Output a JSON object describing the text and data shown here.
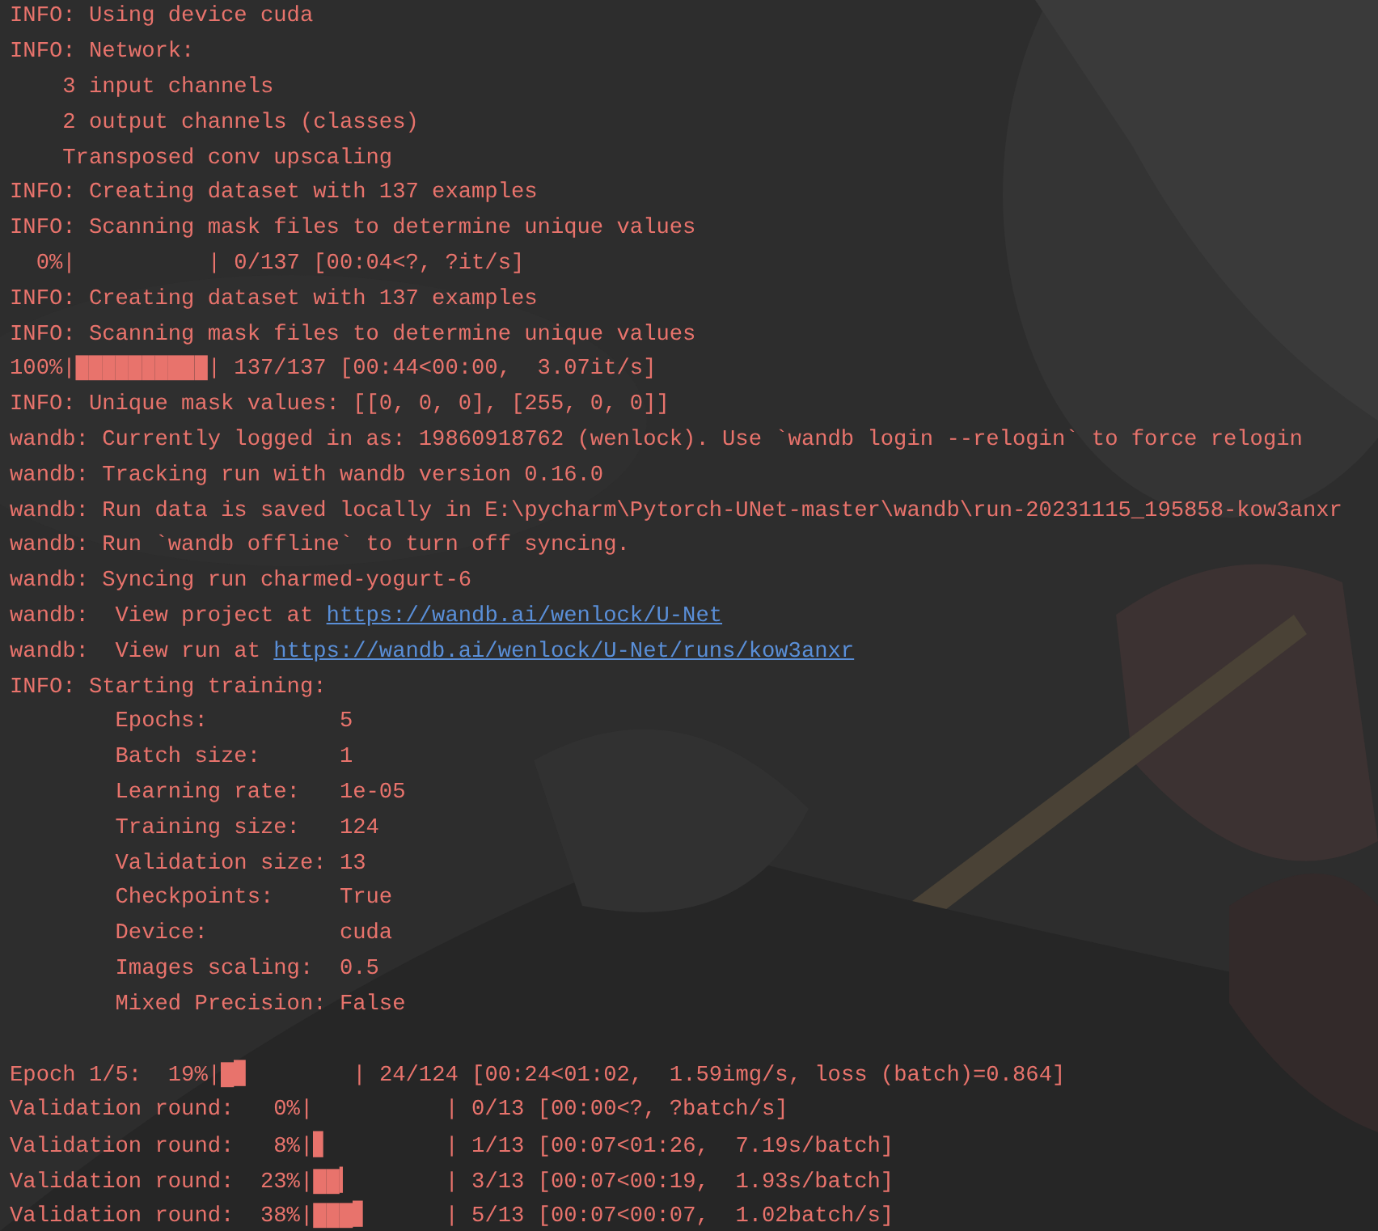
{
  "console": {
    "lines": [
      {
        "kind": "text",
        "text": "INFO: Using device cuda"
      },
      {
        "kind": "text",
        "text": "INFO: Network:"
      },
      {
        "kind": "text",
        "text": "    3 input channels"
      },
      {
        "kind": "text",
        "text": "    2 output channels (classes)"
      },
      {
        "kind": "text",
        "text": "    Transposed conv upscaling"
      },
      {
        "kind": "text",
        "text": "INFO: Creating dataset with 137 examples"
      },
      {
        "kind": "text",
        "text": "INFO: Scanning mask files to determine unique values"
      },
      {
        "kind": "text",
        "text": "  0%|          | 0/137 [00:04<?, ?it/s]"
      },
      {
        "kind": "text",
        "text": "INFO: Creating dataset with 137 examples"
      },
      {
        "kind": "text",
        "text": "INFO: Scanning mask files to determine unique values"
      },
      {
        "kind": "text",
        "text": "100%|██████████| 137/137 [00:44<00:00,  3.07it/s]"
      },
      {
        "kind": "text",
        "text": "INFO: Unique mask values: [[0, 0, 0], [255, 0, 0]]"
      },
      {
        "kind": "text",
        "text": "wandb: Currently logged in as: 19860918762 (wenlock). Use `wandb login --relogin` to force relogin"
      },
      {
        "kind": "text",
        "text": "wandb: Tracking run with wandb version 0.16.0"
      },
      {
        "kind": "text",
        "text": "wandb: Run data is saved locally in E:\\pycharm\\Pytorch-UNet-master\\wandb\\run-20231115_195858-kow3anxr"
      },
      {
        "kind": "text",
        "text": "wandb: Run `wandb offline` to turn off syncing."
      },
      {
        "kind": "text",
        "text": "wandb: Syncing run charmed-yogurt-6"
      },
      {
        "kind": "link",
        "prefix": "wandb:  View project at ",
        "url": "https://wandb.ai/wenlock/U-Net"
      },
      {
        "kind": "link",
        "prefix": "wandb:  View run at ",
        "url": "https://wandb.ai/wenlock/U-Net/runs/kow3anxr"
      },
      {
        "kind": "text",
        "text": "INFO: Starting training:"
      },
      {
        "kind": "text",
        "text": "        Epochs:          5"
      },
      {
        "kind": "text",
        "text": "        Batch size:      1"
      },
      {
        "kind": "text",
        "text": "        Learning rate:   1e-05"
      },
      {
        "kind": "text",
        "text": "        Training size:   124"
      },
      {
        "kind": "text",
        "text": "        Validation size: 13"
      },
      {
        "kind": "text",
        "text": "        Checkpoints:     True"
      },
      {
        "kind": "text",
        "text": "        Device:          cuda"
      },
      {
        "kind": "text",
        "text": "        Images scaling:  0.5"
      },
      {
        "kind": "text",
        "text": "        Mixed Precision: False"
      },
      {
        "kind": "blank"
      },
      {
        "kind": "text",
        "text": "Epoch 1/5:  19%|█▉        | 24/124 [00:24<01:02,  1.59img/s, loss (batch)=0.864]"
      },
      {
        "kind": "text",
        "text": "Validation round:   0%|          | 0/13 [00:00<?, ?batch/s]"
      },
      {
        "kind": "text",
        "text": "Validation round:   8%|▊         | 1/13 [00:07<01:26,  7.19s/batch]"
      },
      {
        "kind": "text",
        "text": "Validation round:  23%|██▎       | 3/13 [00:07<00:19,  1.93s/batch]"
      },
      {
        "kind": "text",
        "text": "Validation round:  38%|███▊      | 5/13 [00:07<00:07,  1.02batch/s]"
      }
    ]
  }
}
